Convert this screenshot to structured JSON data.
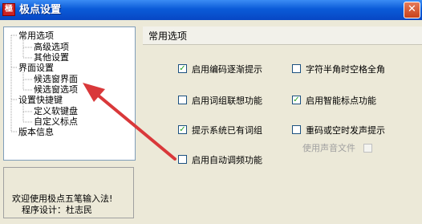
{
  "window": {
    "title": "极点设置",
    "icon": "app-logo-icon",
    "icon_glyph": "極",
    "close_glyph": "✕"
  },
  "tree": {
    "items": [
      {
        "label": "常用选项",
        "level": 0
      },
      {
        "label": "高级选项",
        "level": 1
      },
      {
        "label": "其他设置",
        "level": 1
      },
      {
        "label": "界面设置",
        "level": 0
      },
      {
        "label": "候选窗界面",
        "level": 1
      },
      {
        "label": "候选窗选项",
        "level": 1
      },
      {
        "label": "设置快捷键",
        "level": 0
      },
      {
        "label": "定义软键盘",
        "level": 1
      },
      {
        "label": "自定义标点",
        "level": 1
      },
      {
        "label": "版本信息",
        "level": 0
      }
    ]
  },
  "welcome": {
    "line1": "欢迎使用极点五笔输入法!",
    "line2": "程序设计：杜志民"
  },
  "panel": {
    "title": "常用选项",
    "options": [
      {
        "label": "启用编码逐渐提示",
        "checked": true
      },
      {
        "label": "字符半角时空格全角",
        "checked": false
      },
      {
        "label": "启用词组联想功能",
        "checked": false
      },
      {
        "label": "启用智能标点功能",
        "checked": true
      },
      {
        "label": "提示系统已有词组",
        "checked": true
      },
      {
        "label": "重码或空时发声提示",
        "checked": false
      },
      {
        "label": "使用声音文件",
        "checked": false,
        "disabled": true
      },
      {
        "label": "启用自动调频功能",
        "checked": false
      }
    ],
    "check_glyph": "✓"
  },
  "annotation": {
    "arrow_color": "#d9383a"
  }
}
